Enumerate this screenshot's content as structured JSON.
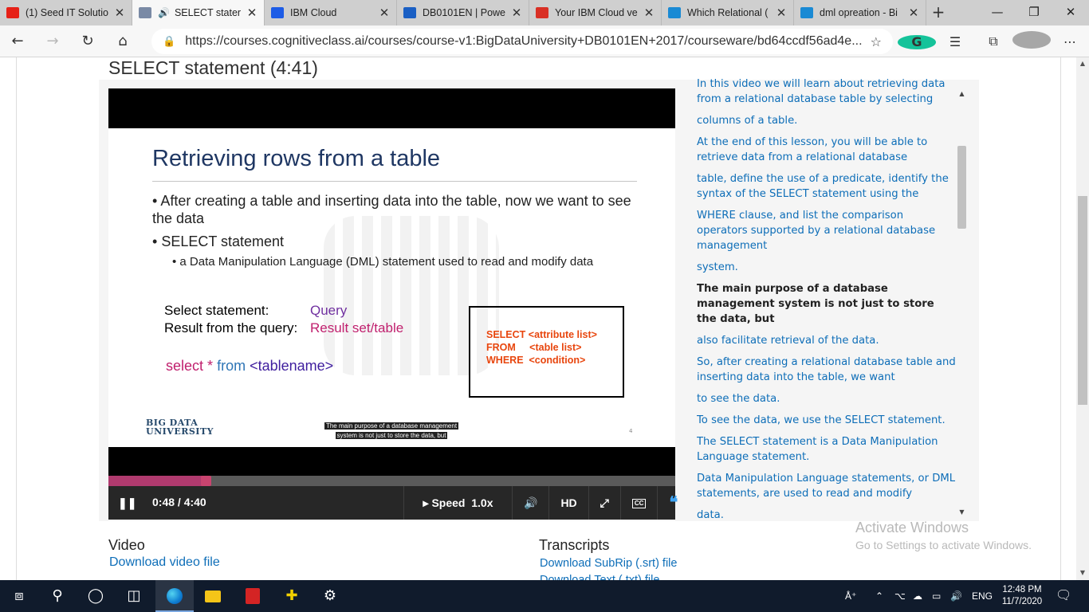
{
  "browser": {
    "tabs": [
      {
        "title": "(1) Seed IT Solutio",
        "fav": "youtube-icon",
        "color": "#e62117",
        "active": false
      },
      {
        "title": "SELECT stater",
        "fav": "cognitiveclass-icon",
        "color": "#7a8aa5",
        "active": true,
        "audio": true
      },
      {
        "title": "IBM Cloud",
        "fav": "ibm-cloud-icon",
        "color": "#1d5ce6",
        "active": false
      },
      {
        "title": "DB0101EN | Powe",
        "fav": "box-icon",
        "color": "#1a5fc4",
        "active": false
      },
      {
        "title": "Your IBM Cloud ve",
        "fav": "gmail-icon",
        "color": "#d93025",
        "active": false
      },
      {
        "title": "Which Relational (",
        "fav": "bing-icon",
        "color": "#1a8ad4",
        "active": false
      },
      {
        "title": "dml opreation - Bi",
        "fav": "bing-icon",
        "color": "#1a8ad4",
        "active": false
      }
    ],
    "new_tab": "+",
    "url": "https://courses.cognitiveclass.ai/courses/course-v1:BigDataUniversity+DB0101EN+2017/courseware/bd64ccdf56ad4e...",
    "grammarly_letter": "G"
  },
  "page": {
    "title": "SELECT statement (4:41)",
    "slide": {
      "title": "Retrieving rows from a table",
      "bullet1": "After creating a table and inserting data into the table, now we want to see the data",
      "bullet2": "SELECT statement",
      "bullet3": "a Data Manipulation Language (DML) statement used to read and modify data",
      "label_select": "Select statement:",
      "label_result": "Result from the query:",
      "value_query": "Query",
      "value_result": "Result set/table",
      "sql_select": "select",
      "sql_star": "*",
      "sql_from": "from",
      "sql_table": "<tablename>",
      "syntax": [
        "SELECT <attribute list>",
        "FROM     <table list>",
        "WHERE  <condition>"
      ],
      "logo_line1": "BIG DATA",
      "logo_line2": "UNIVERSITY",
      "caption_line1": "The main purpose of a database management",
      "caption_line2": "system is not just to store the data, but",
      "slide_number": "4"
    },
    "player": {
      "time": "0:48 / 4:40",
      "progress": 0.172,
      "speed_label": "Speed",
      "speed_value": "1.0x",
      "hd": "HD",
      "cc": "CC"
    },
    "transcript": [
      {
        "text": "In this video we will learn about retrieving data from a relational database table by selecting",
        "current": false
      },
      {
        "text": "columns of a table.",
        "current": false
      },
      {
        "text": "At the end of this lesson, you will be able to retrieve data from a relational database",
        "current": false
      },
      {
        "text": "table, define the use of a predicate, identify the syntax of the SELECT statement using the",
        "current": false
      },
      {
        "text": "WHERE clause, and list the comparison operators supported by a relational database management",
        "current": false
      },
      {
        "text": "system.",
        "current": false
      },
      {
        "text": "The main purpose of a database management system is not just to store the data, but",
        "current": true
      },
      {
        "text": "also facilitate retrieval of the data.",
        "current": false
      },
      {
        "text": "So, after creating a relational database table and inserting data into the table, we want",
        "current": false
      },
      {
        "text": "to see the data.",
        "current": false
      },
      {
        "text": "To see the data, we use the SELECT statement.",
        "current": false
      },
      {
        "text": "The SELECT statement is a Data Manipulation Language statement.",
        "current": false
      },
      {
        "text": "Data Manipulation Language statements, or DML statements, are used to read and modify",
        "current": false
      },
      {
        "text": "data.",
        "current": false
      }
    ],
    "video_section": {
      "heading": "Video",
      "link": "Download video file"
    },
    "transcripts_section": {
      "heading": "Transcripts",
      "link1": "Download SubRip (.srt) file",
      "link2": "Download Text (.txt) file"
    },
    "activate": {
      "line1": "Activate Windows",
      "line2": "Go to Settings to activate Windows."
    }
  },
  "taskbar": {
    "lang": "ENG",
    "time": "12:48 PM",
    "date": "11/7/2020"
  }
}
